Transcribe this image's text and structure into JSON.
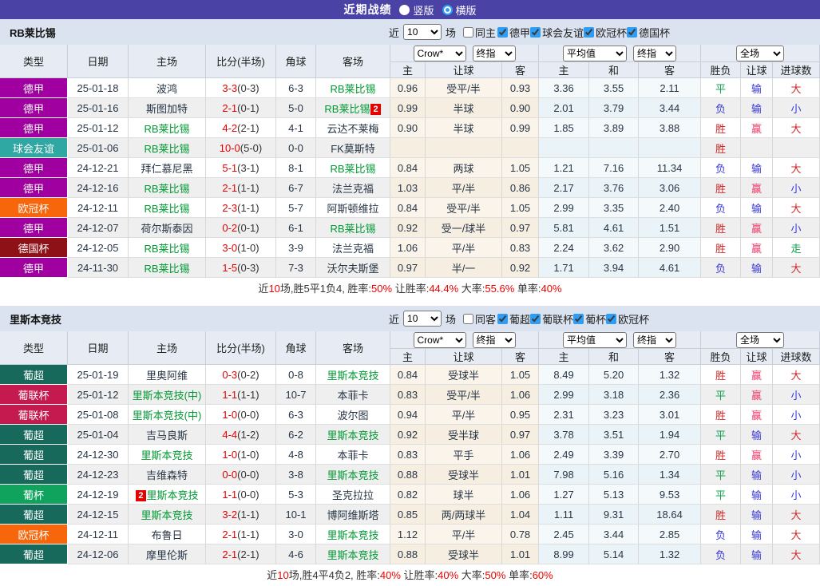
{
  "topbar": {
    "title": "近期战绩",
    "radios": [
      {
        "label": "竖版",
        "selected": false
      },
      {
        "label": "横版",
        "selected": true
      }
    ]
  },
  "theme": {
    "topbar_bg": "#4a42a4",
    "band_bg": "#dae3ef",
    "header_bg": "#e7ecf4",
    "accent_blue": "#2f9df4",
    "team_green": "#009933",
    "score_red": "#e60000",
    "badge_red": "#e60000",
    "summary_red": "#ee0000",
    "type_colors": {
      "德甲": "#a000a0",
      "球会友谊": "#2fa8a3",
      "欧冠杯": "#f7660a",
      "德国杯": "#8e1118",
      "葡超": "#17695c",
      "葡联杯": "#c41a4f",
      "葡杯": "#10a35d"
    },
    "result_colors": {
      "red": "#d02828",
      "green": "#11a050",
      "blue": "#3838d8",
      "pink": "#ee3a68"
    }
  },
  "sections": [
    {
      "team": "RB莱比锡",
      "near_label": "近",
      "near_value": "10",
      "games_label": "场",
      "same_venue": {
        "label": "同主",
        "checked": false
      },
      "leagues": [
        {
          "label": "德甲",
          "checked": true
        },
        {
          "label": "球会友谊",
          "checked": true
        },
        {
          "label": "欧冠杯",
          "checked": true
        },
        {
          "label": "德国杯",
          "checked": true
        }
      ],
      "col_headers": [
        "类型",
        "日期",
        "主场",
        "比分(半场)",
        "角球",
        "客场"
      ],
      "odds_group": {
        "select1": "Crow*",
        "select2": "终指",
        "cols": [
          "主",
          "让球",
          "客"
        ]
      },
      "avg_group": {
        "select1": "平均值",
        "select2": "终指",
        "cols": [
          "主",
          "和",
          "客"
        ]
      },
      "result_group": {
        "select": "全场",
        "cols": [
          "胜负",
          "让球",
          "进球数"
        ]
      },
      "rows": [
        {
          "type": "德甲",
          "date": "25-01-18",
          "home": {
            "name": "波鸿"
          },
          "score_full": "3-3",
          "score_half": "(0-3)",
          "corner": "6-3",
          "away": {
            "name": "RB莱比锡",
            "green": true
          },
          "odds": [
            "0.96",
            "受平/半",
            "0.93"
          ],
          "avg": [
            "3.36",
            "3.55",
            "2.11"
          ],
          "results": [
            [
              "平",
              "green"
            ],
            [
              "输",
              "blue"
            ],
            [
              "大",
              "red"
            ]
          ]
        },
        {
          "type": "德甲",
          "date": "25-01-16",
          "home": {
            "name": "斯图加特"
          },
          "score_full": "2-1",
          "score_half": "(0-1)",
          "corner": "5-0",
          "away": {
            "name": "RB莱比锡",
            "green": true,
            "badge_post": "2"
          },
          "odds": [
            "0.99",
            "半球",
            "0.90"
          ],
          "avg": [
            "2.01",
            "3.79",
            "3.44"
          ],
          "results": [
            [
              "负",
              "blue"
            ],
            [
              "输",
              "blue"
            ],
            [
              "小",
              "blue"
            ]
          ]
        },
        {
          "type": "德甲",
          "date": "25-01-12",
          "home": {
            "name": "RB莱比锡",
            "green": true
          },
          "score_full": "4-2",
          "score_half": "(2-1)",
          "corner": "4-1",
          "away": {
            "name": "云达不莱梅"
          },
          "odds": [
            "0.90",
            "半球",
            "0.99"
          ],
          "avg": [
            "1.85",
            "3.89",
            "3.88"
          ],
          "results": [
            [
              "胜",
              "red"
            ],
            [
              "赢",
              "pink"
            ],
            [
              "大",
              "red"
            ]
          ]
        },
        {
          "type": "球会友谊",
          "date": "25-01-06",
          "home": {
            "name": "RB莱比锡",
            "green": true
          },
          "score_full": "10-0",
          "score_half": "(5-0)",
          "corner": "0-0",
          "away": {
            "name": "FK莫斯特"
          },
          "odds": [
            "",
            "",
            ""
          ],
          "avg": [
            "",
            "",
            ""
          ],
          "results": [
            [
              "胜",
              "red"
            ],
            [
              "",
              ""
            ],
            [
              "",
              ""
            ]
          ]
        },
        {
          "type": "德甲",
          "date": "24-12-21",
          "home": {
            "name": "拜仁慕尼黑"
          },
          "score_full": "5-1",
          "score_half": "(3-1)",
          "corner": "8-1",
          "away": {
            "name": "RB莱比锡",
            "green": true
          },
          "odds": [
            "0.84",
            "两球",
            "1.05"
          ],
          "avg": [
            "1.21",
            "7.16",
            "11.34"
          ],
          "results": [
            [
              "负",
              "blue"
            ],
            [
              "输",
              "blue"
            ],
            [
              "大",
              "red"
            ]
          ]
        },
        {
          "type": "德甲",
          "date": "24-12-16",
          "home": {
            "name": "RB莱比锡",
            "green": true
          },
          "score_full": "2-1",
          "score_half": "(1-1)",
          "corner": "6-7",
          "away": {
            "name": "法兰克福"
          },
          "odds": [
            "1.03",
            "平/半",
            "0.86"
          ],
          "avg": [
            "2.17",
            "3.76",
            "3.06"
          ],
          "results": [
            [
              "胜",
              "red"
            ],
            [
              "赢",
              "pink"
            ],
            [
              "小",
              "blue"
            ]
          ]
        },
        {
          "type": "欧冠杯",
          "date": "24-12-11",
          "home": {
            "name": "RB莱比锡",
            "green": true
          },
          "score_full": "2-3",
          "score_half": "(1-1)",
          "corner": "5-7",
          "away": {
            "name": "阿斯顿维拉"
          },
          "odds": [
            "0.84",
            "受平/半",
            "1.05"
          ],
          "avg": [
            "2.99",
            "3.35",
            "2.40"
          ],
          "results": [
            [
              "负",
              "blue"
            ],
            [
              "输",
              "blue"
            ],
            [
              "大",
              "red"
            ]
          ]
        },
        {
          "type": "德甲",
          "date": "24-12-07",
          "home": {
            "name": "荷尔斯泰因"
          },
          "score_full": "0-2",
          "score_half": "(0-1)",
          "corner": "6-1",
          "away": {
            "name": "RB莱比锡",
            "green": true
          },
          "odds": [
            "0.92",
            "受一/球半",
            "0.97"
          ],
          "avg": [
            "5.81",
            "4.61",
            "1.51"
          ],
          "results": [
            [
              "胜",
              "red"
            ],
            [
              "赢",
              "pink"
            ],
            [
              "小",
              "blue"
            ]
          ]
        },
        {
          "type": "德国杯",
          "date": "24-12-05",
          "home": {
            "name": "RB莱比锡",
            "green": true
          },
          "score_full": "3-0",
          "score_half": "(1-0)",
          "corner": "3-9",
          "away": {
            "name": "法兰克福"
          },
          "odds": [
            "1.06",
            "平/半",
            "0.83"
          ],
          "avg": [
            "2.24",
            "3.62",
            "2.90"
          ],
          "results": [
            [
              "胜",
              "red"
            ],
            [
              "赢",
              "pink"
            ],
            [
              "走",
              "green"
            ]
          ]
        },
        {
          "type": "德甲",
          "date": "24-11-30",
          "home": {
            "name": "RB莱比锡",
            "green": true
          },
          "score_full": "1-5",
          "score_half": "(0-3)",
          "corner": "7-3",
          "away": {
            "name": "沃尔夫斯堡"
          },
          "odds": [
            "0.97",
            "半/一",
            "0.92"
          ],
          "avg": [
            "1.71",
            "3.94",
            "4.61"
          ],
          "results": [
            [
              "负",
              "blue"
            ],
            [
              "输",
              "blue"
            ],
            [
              "大",
              "red"
            ]
          ]
        }
      ],
      "summary": [
        [
          "近",
          ""
        ],
        [
          "10",
          "red"
        ],
        [
          "场,胜5平1负4, 胜率:",
          ""
        ],
        [
          "50%",
          "red"
        ],
        [
          " 让胜率:",
          ""
        ],
        [
          "44.4%",
          "red"
        ],
        [
          " 大率:",
          ""
        ],
        [
          "55.6%",
          "red"
        ],
        [
          " 单率:",
          ""
        ],
        [
          "40%",
          "red"
        ]
      ]
    },
    {
      "team": "里斯本竞技",
      "near_label": "近",
      "near_value": "10",
      "games_label": "场",
      "same_venue": {
        "label": "同客",
        "checked": false
      },
      "leagues": [
        {
          "label": "葡超",
          "checked": true
        },
        {
          "label": "葡联杯",
          "checked": true
        },
        {
          "label": "葡杯",
          "checked": true
        },
        {
          "label": "欧冠杯",
          "checked": true
        }
      ],
      "col_headers": [
        "类型",
        "日期",
        "主场",
        "比分(半场)",
        "角球",
        "客场"
      ],
      "odds_group": {
        "select1": "Crow*",
        "select2": "终指",
        "cols": [
          "主",
          "让球",
          "客"
        ]
      },
      "avg_group": {
        "select1": "平均值",
        "select2": "终指",
        "cols": [
          "主",
          "和",
          "客"
        ]
      },
      "result_group": {
        "select": "全场",
        "cols": [
          "胜负",
          "让球",
          "进球数"
        ]
      },
      "rows": [
        {
          "type": "葡超",
          "date": "25-01-19",
          "home": {
            "name": "里奥阿维"
          },
          "score_full": "0-3",
          "score_half": "(0-2)",
          "corner": "0-8",
          "away": {
            "name": "里斯本竞技",
            "green": true
          },
          "odds": [
            "0.84",
            "受球半",
            "1.05"
          ],
          "avg": [
            "8.49",
            "5.20",
            "1.32"
          ],
          "results": [
            [
              "胜",
              "red"
            ],
            [
              "赢",
              "pink"
            ],
            [
              "大",
              "red"
            ]
          ]
        },
        {
          "type": "葡联杯",
          "date": "25-01-12",
          "home": {
            "name": "里斯本竞技(中)",
            "green": true
          },
          "score_full": "1-1",
          "score_half": "(1-1)",
          "corner": "10-7",
          "away": {
            "name": "本菲卡"
          },
          "odds": [
            "0.83",
            "受平/半",
            "1.06"
          ],
          "avg": [
            "2.99",
            "3.18",
            "2.36"
          ],
          "results": [
            [
              "平",
              "green"
            ],
            [
              "赢",
              "pink"
            ],
            [
              "小",
              "blue"
            ]
          ]
        },
        {
          "type": "葡联杯",
          "date": "25-01-08",
          "home": {
            "name": "里斯本竞技(中)",
            "green": true
          },
          "score_full": "1-0",
          "score_half": "(0-0)",
          "corner": "6-3",
          "away": {
            "name": "波尔图"
          },
          "odds": [
            "0.94",
            "平/半",
            "0.95"
          ],
          "avg": [
            "2.31",
            "3.23",
            "3.01"
          ],
          "results": [
            [
              "胜",
              "red"
            ],
            [
              "赢",
              "pink"
            ],
            [
              "小",
              "blue"
            ]
          ]
        },
        {
          "type": "葡超",
          "date": "25-01-04",
          "home": {
            "name": "吉马良斯"
          },
          "score_full": "4-4",
          "score_half": "(1-2)",
          "corner": "6-2",
          "away": {
            "name": "里斯本竞技",
            "green": true
          },
          "odds": [
            "0.92",
            "受半球",
            "0.97"
          ],
          "avg": [
            "3.78",
            "3.51",
            "1.94"
          ],
          "results": [
            [
              "平",
              "green"
            ],
            [
              "输",
              "blue"
            ],
            [
              "大",
              "red"
            ]
          ]
        },
        {
          "type": "葡超",
          "date": "24-12-30",
          "home": {
            "name": "里斯本竞技",
            "green": true
          },
          "score_full": "1-0",
          "score_half": "(1-0)",
          "corner": "4-8",
          "away": {
            "name": "本菲卡"
          },
          "odds": [
            "0.83",
            "平手",
            "1.06"
          ],
          "avg": [
            "2.49",
            "3.39",
            "2.70"
          ],
          "results": [
            [
              "胜",
              "red"
            ],
            [
              "赢",
              "pink"
            ],
            [
              "小",
              "blue"
            ]
          ]
        },
        {
          "type": "葡超",
          "date": "24-12-23",
          "home": {
            "name": "吉维森特"
          },
          "score_full": "0-0",
          "score_half": "(0-0)",
          "corner": "3-8",
          "away": {
            "name": "里斯本竞技",
            "green": true
          },
          "odds": [
            "0.88",
            "受球半",
            "1.01"
          ],
          "avg": [
            "7.98",
            "5.16",
            "1.34"
          ],
          "results": [
            [
              "平",
              "green"
            ],
            [
              "输",
              "blue"
            ],
            [
              "小",
              "blue"
            ]
          ]
        },
        {
          "type": "葡杯",
          "date": "24-12-19",
          "home": {
            "name": "里斯本竞技",
            "green": true,
            "badge_pre": "2"
          },
          "score_full": "1-1",
          "score_half": "(0-0)",
          "corner": "5-3",
          "away": {
            "name": "圣克拉拉"
          },
          "odds": [
            "0.82",
            "球半",
            "1.06"
          ],
          "avg": [
            "1.27",
            "5.13",
            "9.53"
          ],
          "results": [
            [
              "平",
              "green"
            ],
            [
              "输",
              "blue"
            ],
            [
              "小",
              "blue"
            ]
          ]
        },
        {
          "type": "葡超",
          "date": "24-12-15",
          "home": {
            "name": "里斯本竞技",
            "green": true
          },
          "score_full": "3-2",
          "score_half": "(1-1)",
          "corner": "10-1",
          "away": {
            "name": "博阿维斯塔"
          },
          "odds": [
            "0.85",
            "两/两球半",
            "1.04"
          ],
          "avg": [
            "1.11",
            "9.31",
            "18.64"
          ],
          "results": [
            [
              "胜",
              "red"
            ],
            [
              "输",
              "blue"
            ],
            [
              "大",
              "red"
            ]
          ]
        },
        {
          "type": "欧冠杯",
          "date": "24-12-11",
          "home": {
            "name": "布鲁日"
          },
          "score_full": "2-1",
          "score_half": "(1-1)",
          "corner": "3-0",
          "away": {
            "name": "里斯本竞技",
            "green": true
          },
          "odds": [
            "1.12",
            "平/半",
            "0.78"
          ],
          "avg": [
            "2.45",
            "3.44",
            "2.85"
          ],
          "results": [
            [
              "负",
              "blue"
            ],
            [
              "输",
              "blue"
            ],
            [
              "大",
              "red"
            ]
          ]
        },
        {
          "type": "葡超",
          "date": "24-12-06",
          "home": {
            "name": "摩里伦斯"
          },
          "score_full": "2-1",
          "score_half": "(2-1)",
          "corner": "4-6",
          "away": {
            "name": "里斯本竞技",
            "green": true
          },
          "odds": [
            "0.88",
            "受球半",
            "1.01"
          ],
          "avg": [
            "8.99",
            "5.14",
            "1.32"
          ],
          "results": [
            [
              "负",
              "blue"
            ],
            [
              "输",
              "blue"
            ],
            [
              "大",
              "red"
            ]
          ]
        }
      ],
      "summary": [
        [
          "近",
          ""
        ],
        [
          "10",
          "red"
        ],
        [
          "场,胜4平4负2, 胜率:",
          ""
        ],
        [
          "40%",
          "red"
        ],
        [
          " 让胜率:",
          ""
        ],
        [
          "40%",
          "red"
        ],
        [
          " 大率:",
          ""
        ],
        [
          "50%",
          "red"
        ],
        [
          " 单率:",
          ""
        ],
        [
          "60%",
          "red"
        ]
      ]
    }
  ]
}
